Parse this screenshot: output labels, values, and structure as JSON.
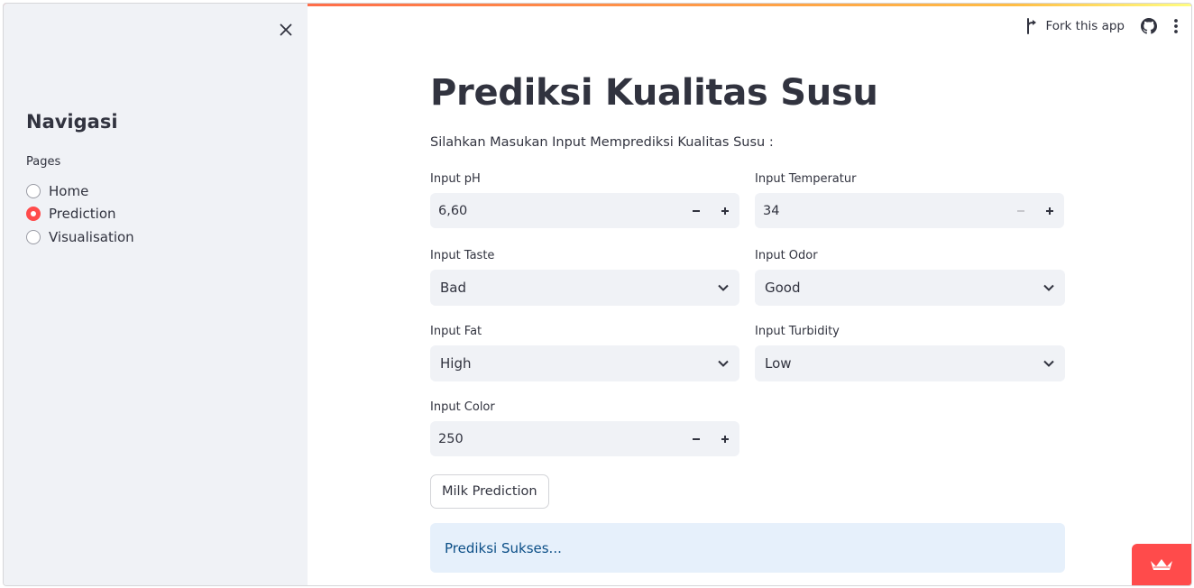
{
  "sidebar": {
    "title": "Navigasi",
    "radio_group_label": "Pages",
    "items": [
      {
        "label": "Home",
        "selected": false
      },
      {
        "label": "Prediction",
        "selected": true
      },
      {
        "label": "Visualisation",
        "selected": false
      }
    ]
  },
  "toolbar": {
    "fork_label": "Fork this app",
    "icons": [
      "fork-icon",
      "github-icon",
      "kebab-menu-icon"
    ]
  },
  "main": {
    "title": "Prediksi Kualitas Susu",
    "subtitle": "Silahkan Masukan Input Memprediksi Kualitas Susu :",
    "fields": {
      "ph": {
        "label": "Input pH",
        "value": "6,60"
      },
      "temperatur": {
        "label": "Input Temperatur",
        "value": "34"
      },
      "taste": {
        "label": "Input Taste",
        "value": "Bad"
      },
      "odor": {
        "label": "Input Odor",
        "value": "Good"
      },
      "fat": {
        "label": "Input Fat",
        "value": "High"
      },
      "turbidity": {
        "label": "Input Turbidity",
        "value": "Low"
      },
      "color": {
        "label": "Input Color",
        "value": "250"
      }
    },
    "button_label": "Milk Prediction",
    "alert_text": "Prediksi Sukses..."
  },
  "colors": {
    "accent": "#ff4b4b",
    "sidebar_bg": "#f0f2f6",
    "input_bg": "#f0f2f6",
    "alert_bg": "#e6f0fb",
    "alert_text": "#0c4f87",
    "text": "#31333f"
  }
}
